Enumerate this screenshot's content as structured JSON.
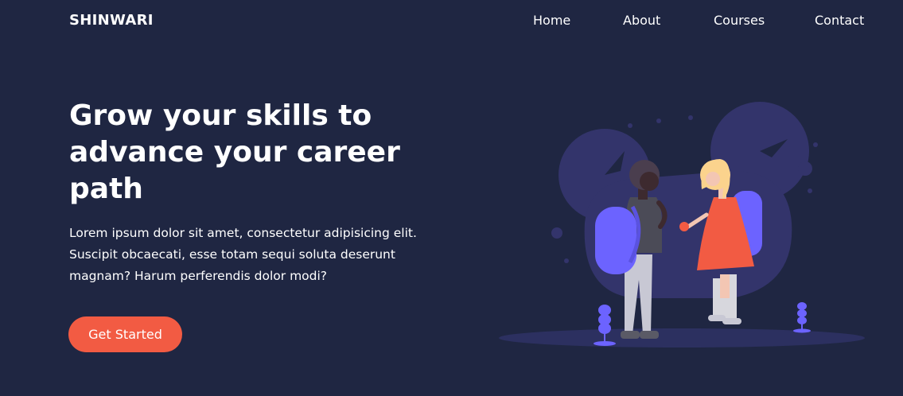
{
  "brand": {
    "logo_text": "SHINWARI"
  },
  "nav": {
    "items": [
      {
        "label": "Home"
      },
      {
        "label": "About"
      },
      {
        "label": "Courses"
      },
      {
        "label": "Contact"
      }
    ]
  },
  "hero": {
    "title": "Grow your skills to advance your career path",
    "description": "Lorem ipsum dolor sit amet, consectetur adipisicing elit. Suscipit obcaecati, esse totam sequi soluta deserunt magnam? Harum perferendis dolor modi?",
    "cta_label": "Get Started"
  },
  "colors": {
    "background": "#1f2642",
    "accent": "#f25b43",
    "illustration_primary": "#6c63ff",
    "illustration_blob": "#33346b"
  },
  "icons": {
    "hero_illustration": "students-with-backpacks-illustration"
  }
}
